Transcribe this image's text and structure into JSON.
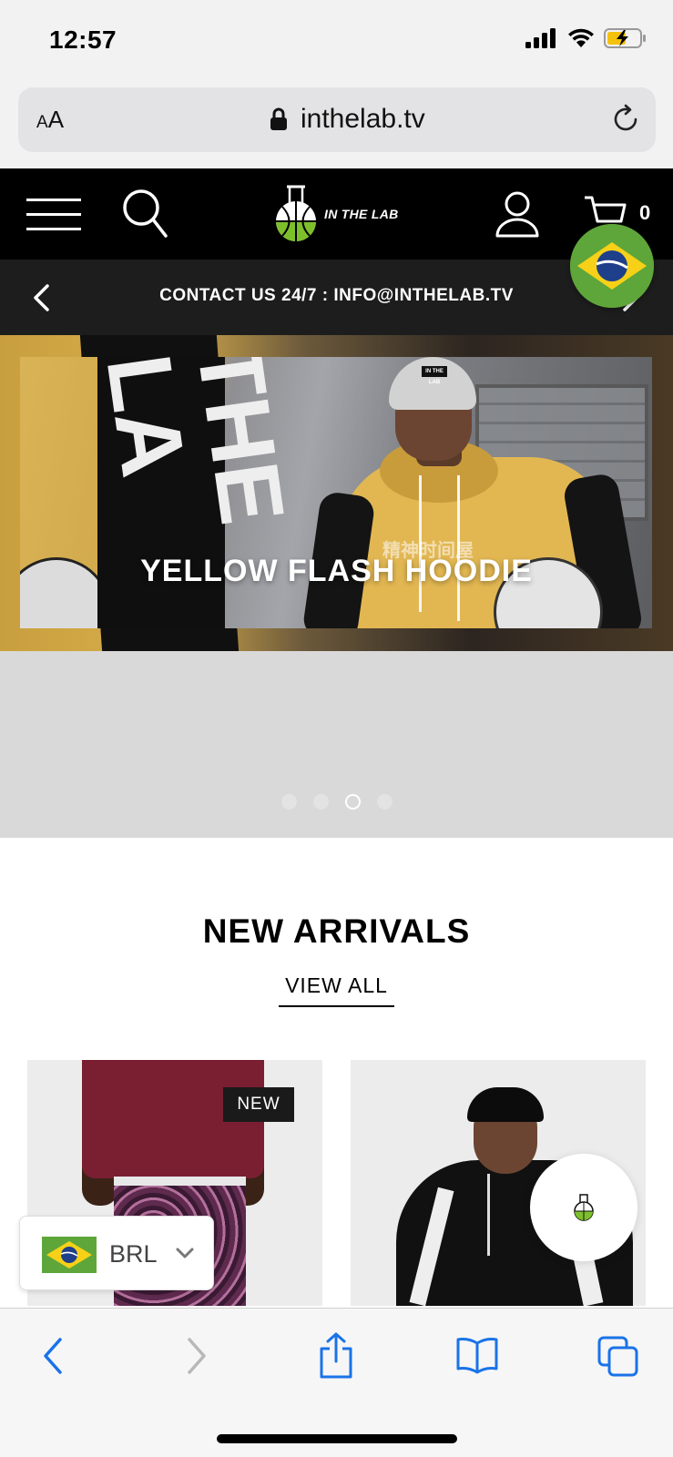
{
  "status_bar": {
    "time": "12:57"
  },
  "browser": {
    "text_size_small": "A",
    "text_size_large": "A",
    "url": "inthelab.tv"
  },
  "header": {
    "logo_text": "IN THE LAB",
    "cart_count": "0"
  },
  "contact_banner": {
    "text": "CONTACT US 24/7 : INFO@INTHELAB.TV"
  },
  "hero": {
    "title": "YELLOW FLASH HOODIE",
    "decor_text": "精神时间屋",
    "stripe_text": "THE LA",
    "beanie_tag": "IN THE LAB",
    "slides": 4,
    "active_slide": 3
  },
  "new_arrivals": {
    "title": "NEW ARRIVALS",
    "view_all": "VIEW ALL",
    "products": [
      {
        "badge": "NEW"
      },
      {
        "badge": ""
      }
    ]
  },
  "currency_selector": {
    "code": "BRL"
  },
  "colors": {
    "brand_green": "#7dc02b",
    "flag_green": "#5fa63a",
    "flag_yellow": "#f7d117",
    "flag_blue": "#1e3f8a",
    "ios_blue": "#1a73e8"
  },
  "icons": [
    "hamburger-icon",
    "search-icon",
    "user-icon",
    "cart-icon",
    "lock-icon",
    "reload-icon",
    "back-icon",
    "forward-icon",
    "share-icon",
    "bookmarks-icon",
    "tabs-icon"
  ]
}
